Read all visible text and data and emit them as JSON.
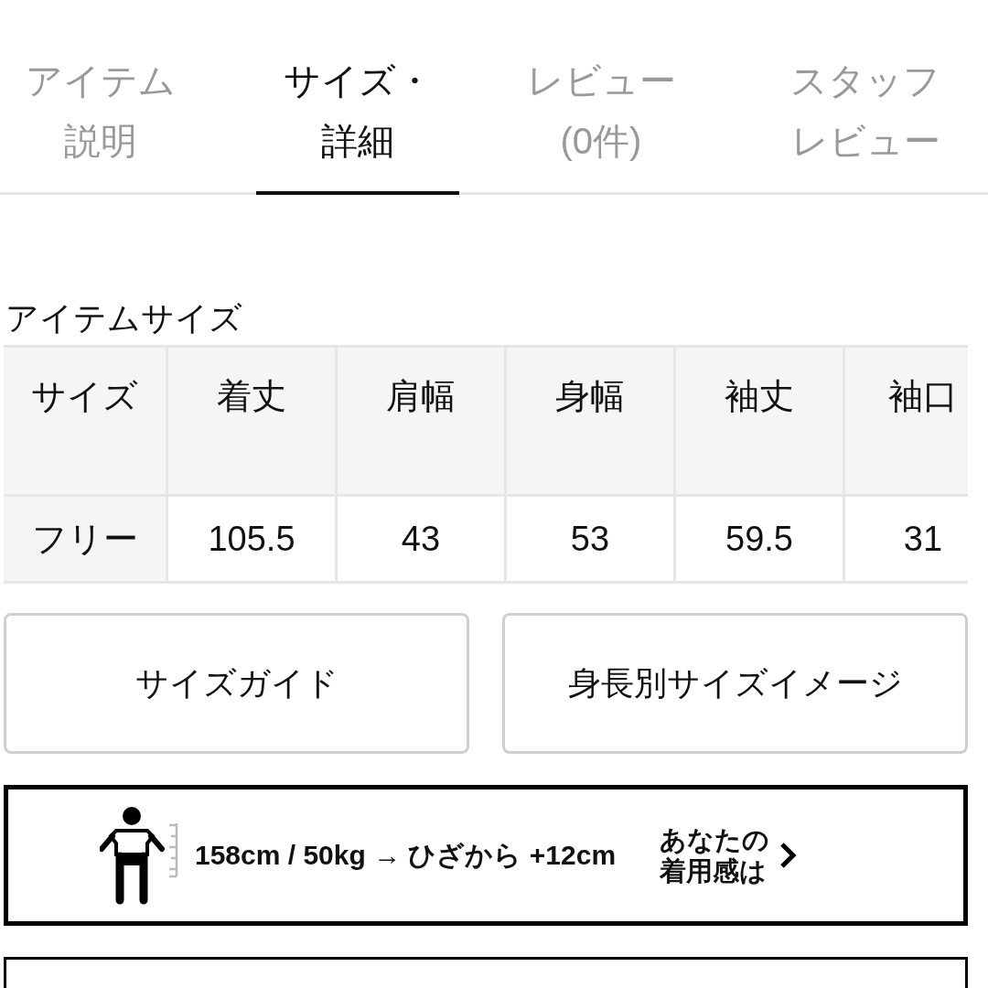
{
  "tabs": [
    {
      "lines": [
        "アイテム",
        "説明"
      ],
      "selected": false
    },
    {
      "lines": [
        "サイズ・",
        "詳細"
      ],
      "selected": true
    },
    {
      "lines": [
        "レビュー",
        "(0件)"
      ],
      "selected": false
    },
    {
      "lines": [
        "スタッフ",
        "レビュー"
      ],
      "selected": false
    }
  ],
  "size_table": {
    "title": "アイテムサイズ",
    "columns": [
      "サイズ",
      "着丈",
      "肩幅",
      "身幅",
      "袖丈",
      "袖口"
    ],
    "rows": [
      [
        "フリー",
        "105.5",
        "43",
        "53",
        "59.5",
        "31"
      ]
    ]
  },
  "buttons": [
    "サイズガイド",
    "身長別サイズイメージ"
  ],
  "fit_banner": {
    "text": "158cm / 50kg → ひざから +12cm",
    "link_lines": [
      "あなたの",
      "着用感は"
    ]
  }
}
